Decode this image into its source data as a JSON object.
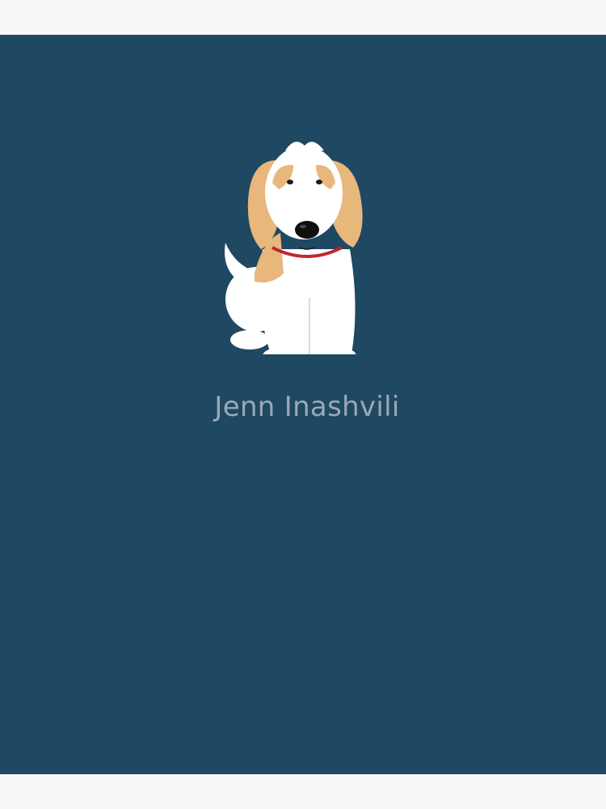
{
  "artwork": {
    "background_color": "#1f4862",
    "page_color": "#f7f7f7",
    "subject_icon": "dog-illustration-icon",
    "fur_colors": {
      "white": "#ffffff",
      "tan": "#e8b77c",
      "collar": "#c0272d"
    }
  },
  "caption": {
    "artist_name": "Jenn Inashvili",
    "text_color": "#9aa9b6"
  }
}
